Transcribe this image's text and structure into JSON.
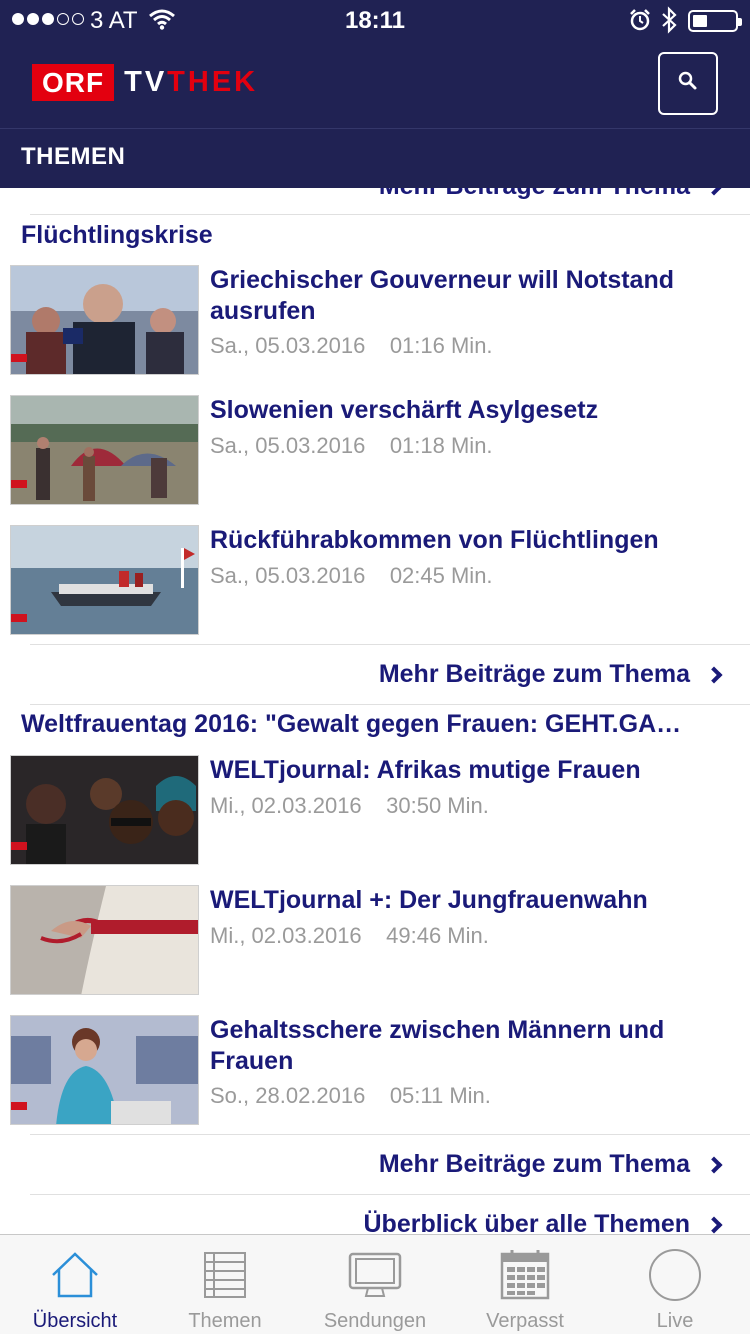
{
  "status_bar": {
    "carrier": "3 AT",
    "time": "18:11",
    "signal_filled": 3,
    "signal_total": 5
  },
  "header": {
    "logo_orf": "ORF",
    "logo_tv": "TV",
    "logo_thek": "THEK",
    "section_title": "THEMEN",
    "search_icon": "search-icon"
  },
  "colors": {
    "header_bg": "#202253",
    "brand_red": "#e3000f",
    "link_blue": "#1a1a78",
    "meta_gray": "#9a9a9a"
  },
  "content": {
    "more_label": "Mehr Beiträge zum Thema",
    "all_topics_label": "Überblick über alle Themen",
    "topics": [
      {
        "title": "Flüchtlingskrise",
        "items": [
          {
            "title": "Griechischer Gouverneur will Notstand ausrufen",
            "date": "Sa., 05.03.2016",
            "duration": "01:16 Min."
          },
          {
            "title": "Slowenien verschärft Asylgesetz",
            "date": "Sa., 05.03.2016",
            "duration": "01:18 Min."
          },
          {
            "title": "Rückführabkommen von Flüchtlingen",
            "date": "Sa., 05.03.2016",
            "duration": "02:45 Min."
          }
        ]
      },
      {
        "title": "Weltfrauentag 2016: \"Gewalt gegen Frauen: GEHT.GA…",
        "items": [
          {
            "title": "WELTjournal: Afrikas mutige Frauen",
            "date": "Mi., 02.03.2016",
            "duration": "30:50 Min."
          },
          {
            "title": "WELTjournal +: Der Jungfrauenwahn",
            "date": "Mi., 02.03.2016",
            "duration": "49:46 Min."
          },
          {
            "title": "Gehaltsschere zwischen Männern und Frauen",
            "date": "So., 28.02.2016",
            "duration": "05:11 Min."
          }
        ]
      }
    ]
  },
  "tabbar": {
    "tabs": [
      {
        "label": "Übersicht",
        "icon": "home-icon",
        "active": true
      },
      {
        "label": "Themen",
        "icon": "list-icon",
        "active": false
      },
      {
        "label": "Sendungen",
        "icon": "tv-icon",
        "active": false
      },
      {
        "label": "Verpasst",
        "icon": "calendar-icon",
        "active": false
      },
      {
        "label": "Live",
        "icon": "live-circle-icon",
        "active": false
      }
    ]
  }
}
